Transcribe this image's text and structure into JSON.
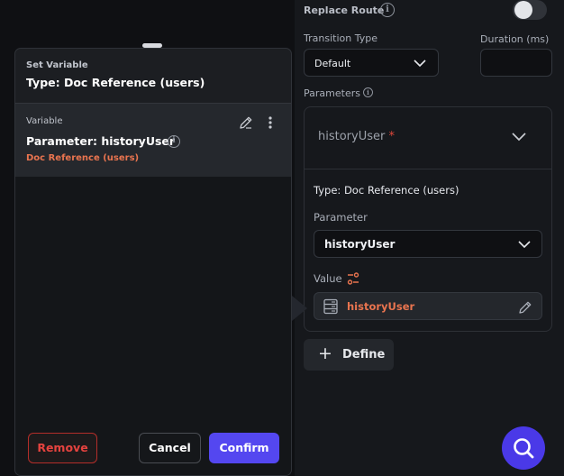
{
  "right_panel": {
    "replace_route_label": "Replace Route",
    "replace_route_on": false,
    "transition_type_label": "Transition Type",
    "transition_type_value": "Default",
    "duration_label": "Duration (ms)",
    "duration_value": "",
    "parameters_label": "Parameters",
    "parameter_card": {
      "name": "historyUser",
      "required_mark": "*",
      "type_text": "Type: Doc Reference (users)",
      "parameter_label": "Parameter",
      "parameter_value": "historyUser",
      "value_label": "Value",
      "value_chip_text": "historyUser"
    },
    "define_button_label": "Define"
  },
  "dialog": {
    "header_small": "Set Variable",
    "header_title": "Type: Doc Reference (users)",
    "variable_small": "Variable",
    "variable_title": "Parameter: historyUser",
    "variable_type": "Doc Reference (users)",
    "remove_label": "Remove",
    "cancel_label": "Cancel",
    "confirm_label": "Confirm"
  },
  "colors": {
    "accent": "#5447f0",
    "danger": "#e6433f",
    "orange": "#e9744f",
    "fab": "#4a39e8"
  }
}
